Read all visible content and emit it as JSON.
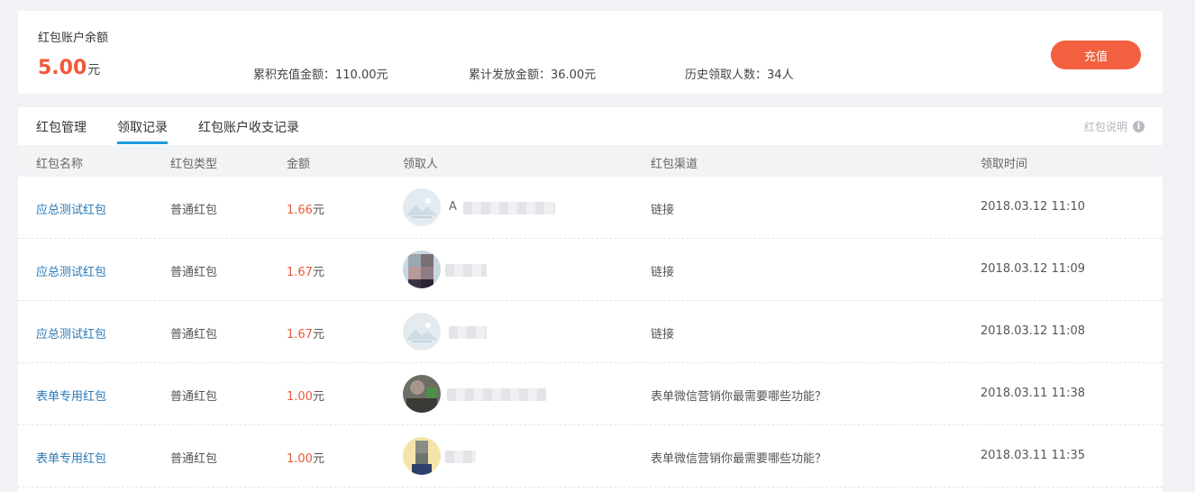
{
  "balance": {
    "title": "红包账户余额",
    "amount": "5.00",
    "unit": "元",
    "stats": [
      "累积充值金额：110.00元",
      "累计发放金额：36.00元",
      "历史领取人数：34人"
    ],
    "recharge_label": "充值"
  },
  "tabs": [
    {
      "label": "红包管理",
      "active": false
    },
    {
      "label": "领取记录",
      "active": true
    },
    {
      "label": "红包账户收支记录",
      "active": false
    }
  ],
  "help": {
    "label": "红包说明",
    "icon": "info-icon",
    "icon_glyph": "i"
  },
  "columns": [
    "红包名称",
    "红包类型",
    "金额",
    "领取人",
    "红包渠道",
    "领取时间"
  ],
  "rows": [
    {
      "name": "应总测试红包",
      "type": "普通红包",
      "amount": "1.66",
      "unit": "元",
      "receiver_visible": "A",
      "avatar": "mountain",
      "channel": "链接",
      "time": "2018.03.12 11:10"
    },
    {
      "name": "应总测试红包",
      "type": "普通红包",
      "amount": "1.67",
      "unit": "元",
      "receiver_visible": "",
      "avatar": "pixelated",
      "channel": "链接",
      "time": "2018.03.12 11:09"
    },
    {
      "name": "应总测试红包",
      "type": "普通红包",
      "amount": "1.67",
      "unit": "元",
      "receiver_visible": "",
      "avatar": "mountain",
      "channel": "链接",
      "time": "2018.03.12 11:08"
    },
    {
      "name": "表单专用红包",
      "type": "普通红包",
      "amount": "1.00",
      "unit": "元",
      "receiver_visible": "",
      "avatar": "photo",
      "channel": "表单微信营销你最需要哪些功能？",
      "time": "2018.03.11 11:38"
    },
    {
      "name": "表单专用红包",
      "type": "普通红包",
      "amount": "1.00",
      "unit": "元",
      "receiver_visible": "",
      "avatar": "photo-yellow",
      "channel": "表单微信营销你最需要哪些功能？",
      "time": "2018.03.11 11:35"
    }
  ],
  "colors": {
    "accent": "#f2603f",
    "link": "#2a7ab8",
    "tab_active": "#1e9ae0",
    "amount": "#e85a3c"
  }
}
